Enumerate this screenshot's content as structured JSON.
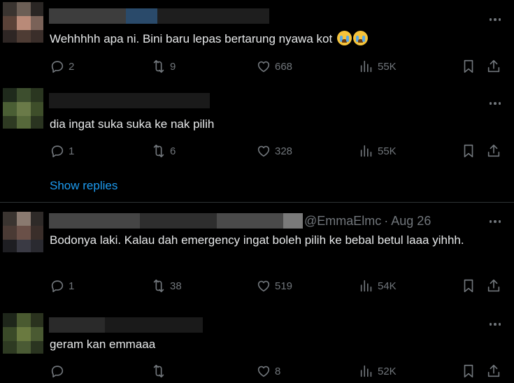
{
  "posts": [
    {
      "handle": "",
      "date": "",
      "text": "Wehhhhh apa ni. Bini baru lepas bertarung nyawa kot",
      "reply_count": "2",
      "repost_count": "9",
      "like_count": "668",
      "view_count": "55K"
    },
    {
      "handle": "",
      "date": "",
      "text": "dia ingat suka suka ke nak pilih",
      "reply_count": "1",
      "repost_count": "6",
      "like_count": "328",
      "view_count": "55K"
    },
    {
      "handle": "@EmmaElmc",
      "date": "· Aug 26",
      "text": "Bodonya laki. Kalau dah emergency ingat boleh pilih ke bebal betul laaa yihhh.",
      "reply_count": "1",
      "repost_count": "38",
      "like_count": "519",
      "view_count": "54K"
    },
    {
      "handle": "",
      "date": "",
      "text": "geram kan emmaaa",
      "reply_count": "",
      "repost_count": "",
      "like_count": "8",
      "view_count": "52K"
    }
  ],
  "show_replies_label": "Show replies",
  "icons": {
    "reply": "reply-icon",
    "repost": "repost-icon",
    "like": "heart-icon",
    "views": "views-icon",
    "bookmark": "bookmark-icon",
    "share": "share-icon",
    "more": "more-icon",
    "emoji": "loudly-crying-face-emoji"
  },
  "colors": {
    "link": "#1d9bf0",
    "muted": "#71767b",
    "text": "#e7e9ea"
  }
}
